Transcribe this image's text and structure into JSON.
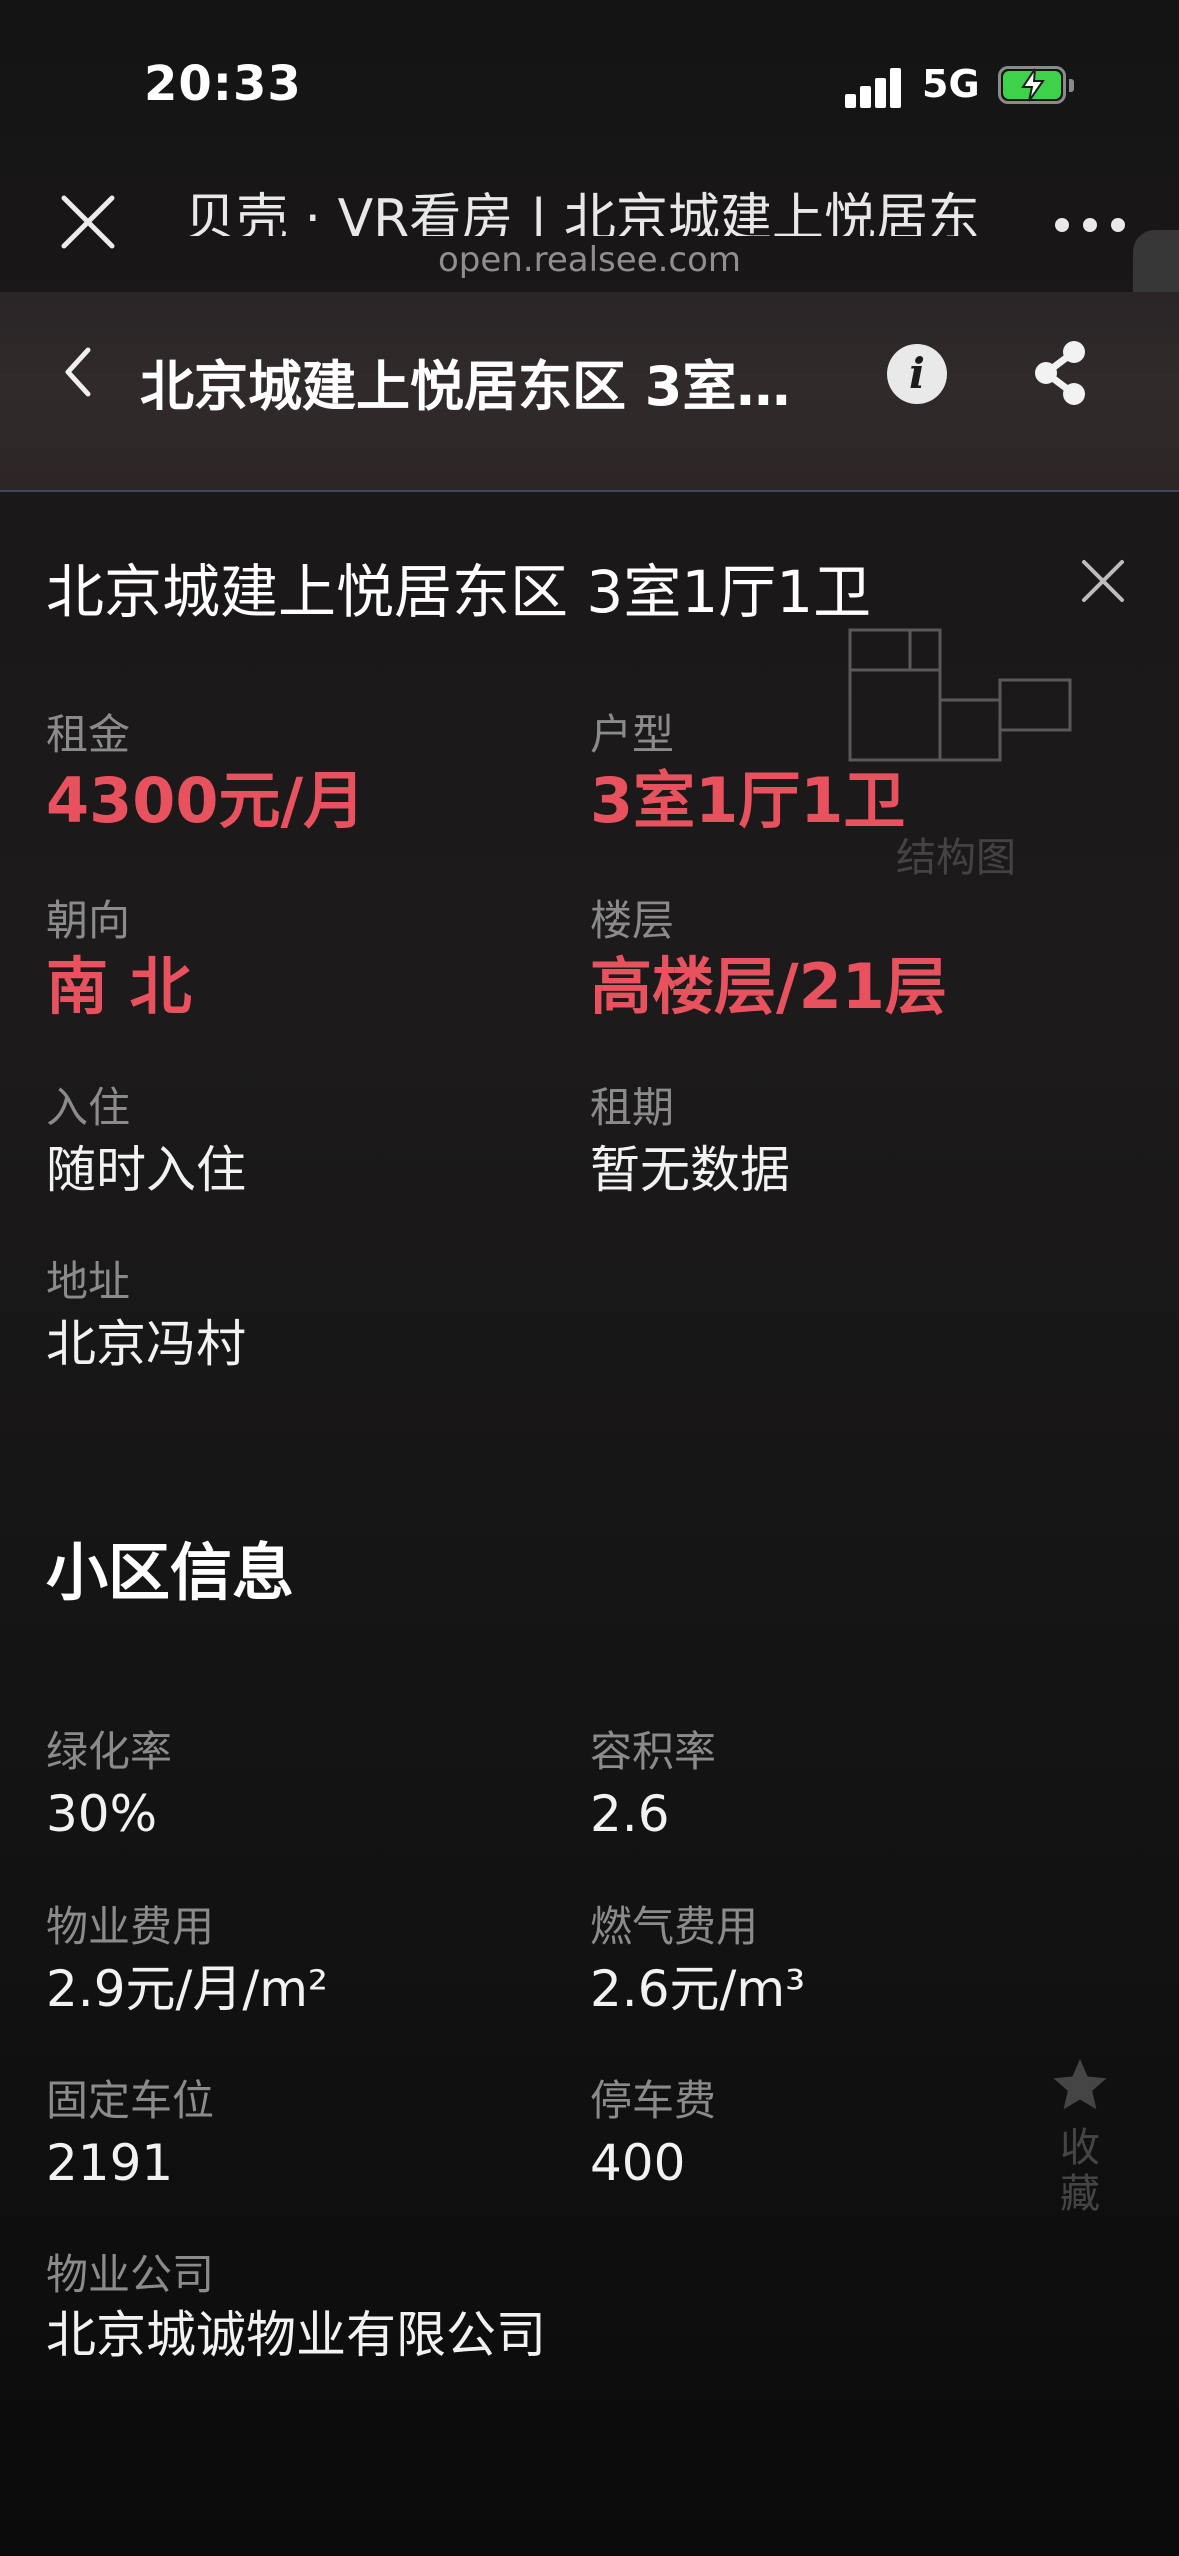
{
  "status_bar": {
    "time": "20:33",
    "network": "5G"
  },
  "webview": {
    "title": "贝壳 · VR看房 | 北京城建上悦居东",
    "url": "open.realsee.com"
  },
  "header": {
    "title": "北京城建上悦居东区 3室…"
  },
  "panel": {
    "title": "北京城建上悦居东区 3室1厅1卫",
    "floorplan_label": "结构图",
    "rent": {
      "label": "租金",
      "value": "4300元/月"
    },
    "layout": {
      "label": "户型",
      "value": "3室1厅1卫"
    },
    "orientation": {
      "label": "朝向",
      "value": "南 北"
    },
    "floor": {
      "label": "楼层",
      "value": "高楼层/21层"
    },
    "move_in": {
      "label": "入住",
      "value": "随时入住"
    },
    "lease": {
      "label": "租期",
      "value": "暂无数据"
    },
    "address": {
      "label": "地址",
      "value": "北京冯村"
    }
  },
  "community": {
    "title": "小区信息",
    "green_rate": {
      "label": "绿化率",
      "value": "30%"
    },
    "plot_ratio": {
      "label": "容积率",
      "value": "2.6"
    },
    "property_fee": {
      "label": "物业费用",
      "value": "2.9元/月/m²"
    },
    "gas_fee": {
      "label": "燃气费用",
      "value": "2.6元/m³"
    },
    "fixed_parking": {
      "label": "固定车位",
      "value": "2191"
    },
    "parking_fee": {
      "label": "停车费",
      "value": "400"
    },
    "property_company": {
      "label": "物业公司",
      "value": "北京城诚物业有限公司"
    }
  },
  "favorite": {
    "label": "收藏"
  },
  "colors": {
    "accent": "#e8525f",
    "battery": "#3ed14a"
  }
}
